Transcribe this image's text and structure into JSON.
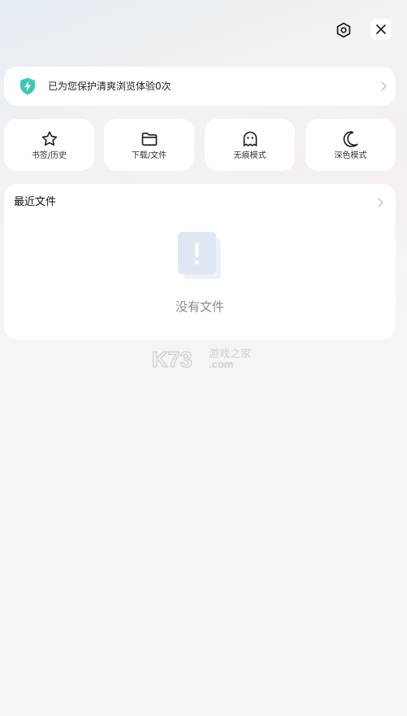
{
  "header": {
    "settings_icon": "settings-hexagon-icon",
    "close_icon": "close-icon"
  },
  "protection": {
    "text": "已为您保护清爽浏览体验0次",
    "icon": "shield-lightning-icon",
    "accent_color": "#3ec8b4"
  },
  "quick_actions": [
    {
      "label": "书签/历史",
      "icon": "star-icon"
    },
    {
      "label": "下载/文件",
      "icon": "folder-icon"
    },
    {
      "label": "无痕模式",
      "icon": "ghost-icon"
    },
    {
      "label": "深色模式",
      "icon": "moon-icon"
    }
  ],
  "recent_files": {
    "title": "最近文件",
    "empty_text": "没有文件",
    "empty_icon": "empty-document-icon"
  },
  "watermark": {
    "logo_text": "K73",
    "site_text": "游戏之家",
    "domain_text": ".com"
  }
}
